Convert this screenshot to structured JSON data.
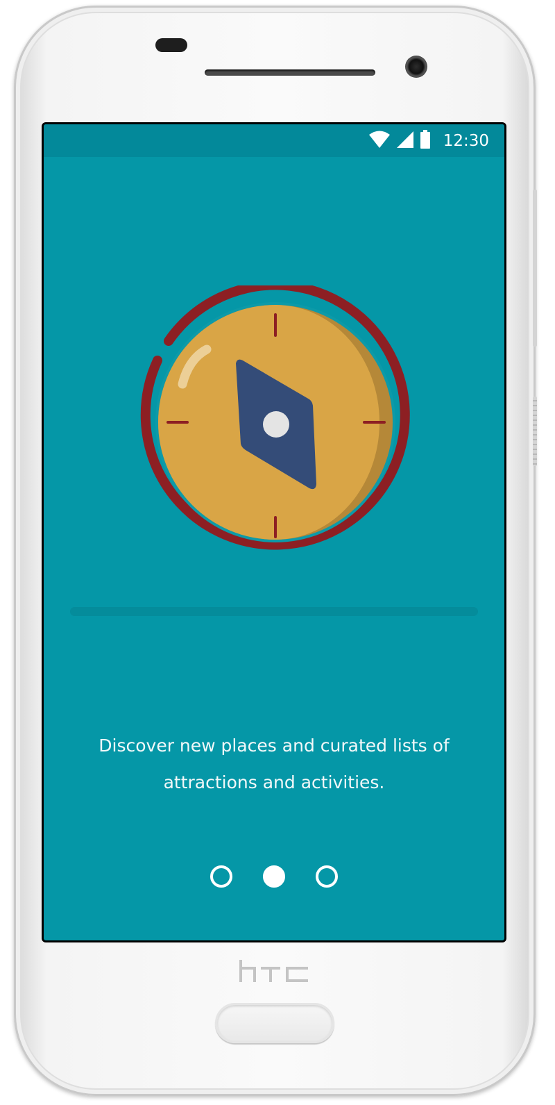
{
  "device": {
    "brand": "htc"
  },
  "status_bar": {
    "time": "12:30",
    "icons": [
      "wifi-icon",
      "cellular-signal-icon",
      "battery-icon"
    ]
  },
  "onboarding": {
    "illustration": "compass-icon",
    "caption": "Discover new places and curated lists of attractions and activities.",
    "pager": {
      "total_pages": 3,
      "current_page": 2
    }
  },
  "colors": {
    "background": "#0597a7",
    "status_bar": "#03899a",
    "compass_ring": "#8d1f23",
    "compass_face": "#d9a546",
    "compass_needle": "#344c78",
    "text": "#f2f8f9"
  }
}
